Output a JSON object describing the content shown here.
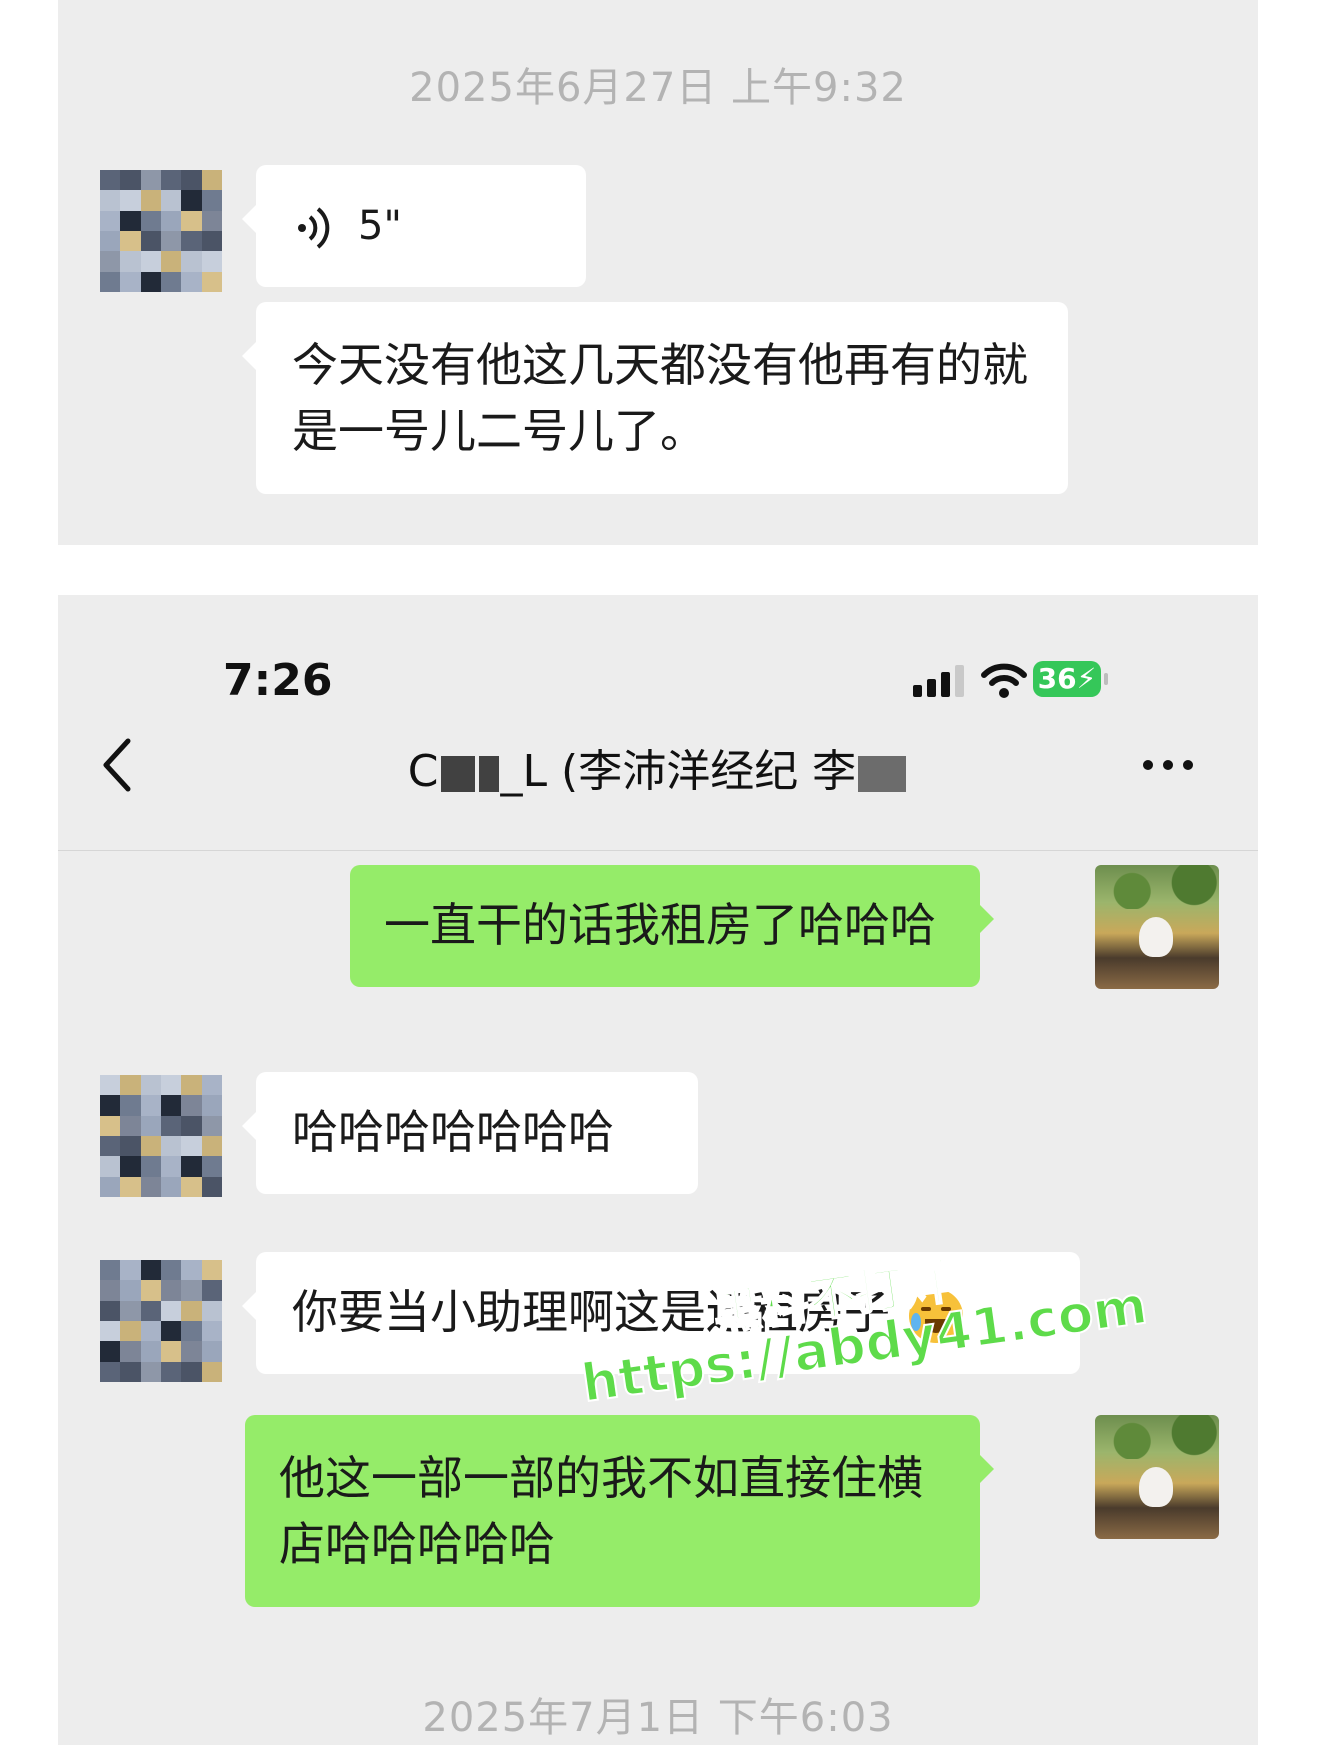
{
  "top": {
    "timestamp": "2025年6月27日 上午9:32",
    "voice_message": {
      "icon": "voice-wave-icon",
      "duration": "5\""
    },
    "text_message": "今天没有他这几天都没有他再有的就是一号儿二号儿了。"
  },
  "status_bar": {
    "time": "7:26",
    "signal_icon": "cellular-signal-icon",
    "wifi_icon": "wifi-icon",
    "battery": "36"
  },
  "nav": {
    "back_icon": "chevron-left-icon",
    "title_prefix": "C",
    "title_mid": "_L (李沛洋经纪 李",
    "more_icon": "more-dots-icon"
  },
  "messages": [
    {
      "side": "right",
      "text": "一直干的话我租房了哈哈哈"
    },
    {
      "side": "left",
      "text": "哈哈哈哈哈哈哈"
    },
    {
      "side": "left",
      "text": "你要当小助理啊这是还租房子"
    },
    {
      "side": "right",
      "text": "他这一部一部的我不如直接住横店哈哈哈哈哈"
    }
  ],
  "bottom_timestamp": "2025年7月1日 下午6:03",
  "watermark": {
    "cn": "黑料不打烊",
    "url": "https://abdy41.com"
  },
  "colors": {
    "sent_bubble": "#95ec69",
    "received_bubble": "#ffffff",
    "background": "#ededed",
    "battery": "#35c759"
  }
}
